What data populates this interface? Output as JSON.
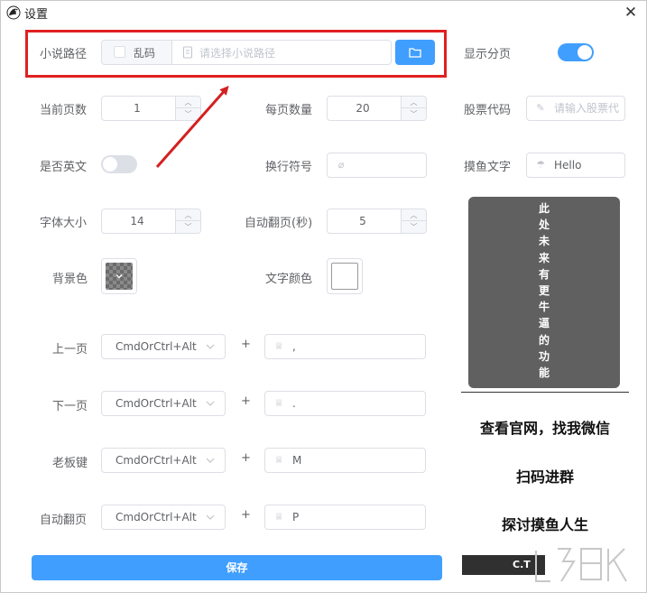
{
  "window": {
    "title": "设置",
    "close_glyph": "✕"
  },
  "novel_path": {
    "label": "小说路径",
    "garbled_checkbox_label": "乱码",
    "placeholder": "请选择小说路径",
    "browse_icon": "folder-icon"
  },
  "show_paging": {
    "label": "显示分页",
    "on": true
  },
  "current_page": {
    "label": "当前页数",
    "value": "1"
  },
  "per_page": {
    "label": "每页数量",
    "value": "20"
  },
  "stock_code": {
    "label": "股票代码",
    "placeholder": "请输入股票代"
  },
  "is_english": {
    "label": "是否英文",
    "on": false
  },
  "line_break": {
    "label": "换行符号",
    "value": ""
  },
  "fish_text": {
    "label": "摸鱼文字",
    "value": "Hello"
  },
  "font_size": {
    "label": "字体大小",
    "value": "14"
  },
  "auto_flip_seconds": {
    "label": "自动翻页(秒)",
    "value": "5"
  },
  "background_color": {
    "label": "背景色"
  },
  "text_color": {
    "label": "文字颜色"
  },
  "shortcuts": [
    {
      "label": "上一页",
      "modifier": "CmdOrCtrl+Alt",
      "key": ","
    },
    {
      "label": "下一页",
      "modifier": "CmdOrCtrl+Alt",
      "key": "."
    },
    {
      "label": "老板键",
      "modifier": "CmdOrCtrl+Alt",
      "key": "M"
    },
    {
      "label": "自动翻页",
      "modifier": "CmdOrCtrl+Alt",
      "key": "P"
    }
  ],
  "plus_sign": "+",
  "save_label": "保存",
  "future_feature_text": "此处未来有更牛逼的功能",
  "promo": {
    "line1": "查看官网，找我微信",
    "line2": "扫码进群",
    "line3": "探讨摸鱼人生"
  },
  "bottom_bar_text": "C.T",
  "colors": {
    "accent": "#409eff",
    "highlight": "#e02020",
    "panel": "#606060"
  }
}
